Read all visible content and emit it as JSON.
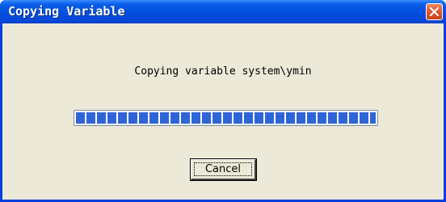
{
  "window": {
    "title": "Copying Variable",
    "close_icon": "close-icon"
  },
  "dialog": {
    "message": "Copying variable system\\ymin",
    "progress_percent": 100,
    "cancel_label": "Cancel"
  },
  "colors": {
    "titlebar": "#0550e0",
    "client_bg": "#ece9d8",
    "progress_fill": "#2f63d8",
    "close_button": "#e05a32"
  }
}
